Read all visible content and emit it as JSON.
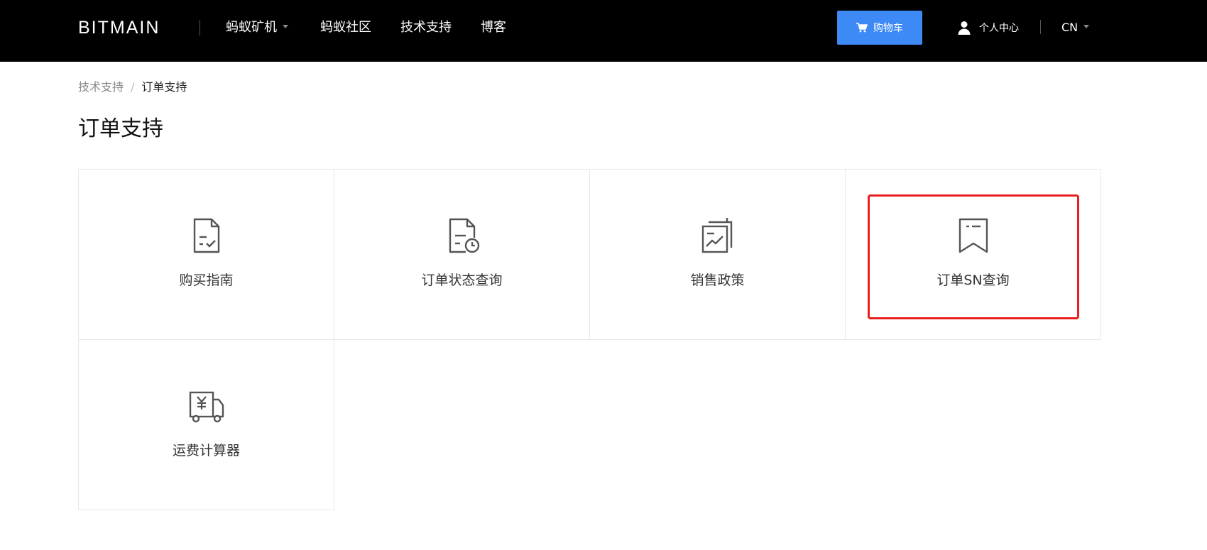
{
  "header": {
    "logo_text": "BITMAIN",
    "nav": [
      "蚂蚁矿机",
      "蚂蚁社区",
      "技术支持",
      "博客"
    ],
    "cart_label": "购物车",
    "user_label": "个人中心",
    "lang_label": "CN"
  },
  "breadcrumb": {
    "parent": "技术支持",
    "separator": "/",
    "current": "订单支持"
  },
  "page_title": "订单支持",
  "cards": [
    {
      "label": "购买指南",
      "icon": "document-check-icon"
    },
    {
      "label": "订单状态查询",
      "icon": "document-clock-icon"
    },
    {
      "label": "销售政策",
      "icon": "document-chart-icon"
    },
    {
      "label": "订单SN查询",
      "icon": "bookmark-icon"
    },
    {
      "label": "运费计算器",
      "icon": "freight-yuan-icon"
    }
  ],
  "colors": {
    "header_bg": "#000000",
    "cart_button": "#3d8af7",
    "highlight_border": "#e8201f"
  }
}
